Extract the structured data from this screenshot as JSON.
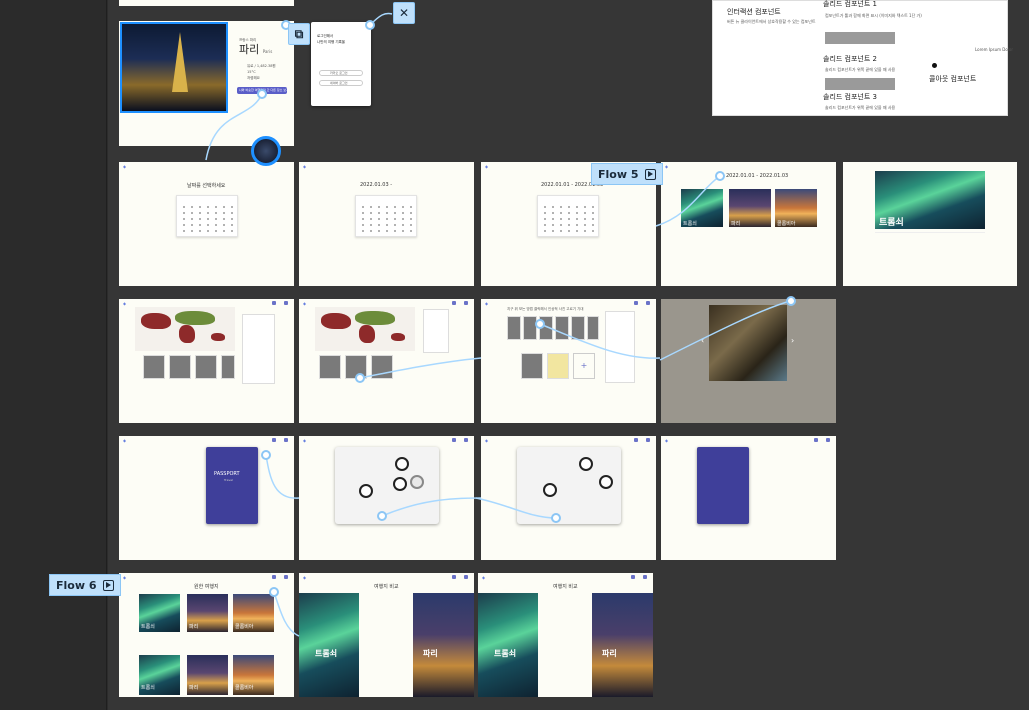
{
  "header_panel": {
    "interaction_title": "인터랙션 컴포넌트",
    "interaction_desc": "버튼 뉴 클라이언트에서 상호작용할 수 있는 컴포넌트",
    "solid1_title": "솔리드 컴포넌트 1",
    "solid1_desc": "컴포넌트가 툴과 함께 화면 표시 (이미지와 텍스트 1단 가)",
    "solid2_title": "솔리드 컴포넌트 2",
    "solid2_desc": "솔리드 컴포넌트가 위쪽 끝에 있을 때 사용",
    "solid3_title": "솔리드 컴포넌트 3",
    "solid3_desc": "솔리드 컴포넌트가 위쪽 끝에 있을 때 사용",
    "hover_title": "콜아웃 컴포넌트",
    "hover_note": "Lorem Ipsum Dolor"
  },
  "paris_card": {
    "subtitle": "프랑스 파리",
    "city": "파리",
    "city_sub": "Paris",
    "info1": "유로 / 1,482.38원",
    "info2": "15°C",
    "info3": "저렴해요",
    "cta": "나와 비슷한 여행자가 간 다른 장소 보기"
  },
  "login_modal": {
    "line1": "로그인해서",
    "line2": "나만의 여행 기록을",
    "btn1": "카카오 로그인",
    "btn2": "네이버 로그인"
  },
  "calendar_frames": [
    {
      "title": "날짜를 선택하세요"
    },
    {
      "title": "2022.01.03 -"
    },
    {
      "title": "2022.01.01 - 2022.01.03"
    }
  ],
  "results_frame": {
    "title": "2022.01.01 - 2022.01.03",
    "city1": "트롬쇠",
    "city2": "파리",
    "city3": "콜롬비아"
  },
  "detail_frame": {
    "city": "트롬쇠"
  },
  "map_frames": [
    {
      "hint": ""
    },
    {
      "hint": ""
    },
    {
      "hint": "지구 위 보는 방법 클릭해서 인상적 사진 고르기 기대"
    }
  ],
  "passport_frame": {
    "title": "PASSPORT",
    "sub": "Travel"
  },
  "compare_frames": [
    {
      "title": "원한 여행지",
      "c1": "트롬쇠",
      "c2": "파리",
      "c3": "콜롬비아",
      "c4": "트롬쇠",
      "c5": "파리",
      "c6": "콜롬비아"
    },
    {
      "title": "여행지 비교",
      "left": "트롬쇠",
      "right": "파리"
    },
    {
      "title": "여행지 비교",
      "left": "트롬쇠",
      "right": "파리"
    }
  ],
  "flows": {
    "flow5": "Flow 5",
    "flow6": "Flow 6"
  },
  "colors": {
    "canvas": "#363636",
    "frame": "#fdfdf6",
    "accent": "#5a5ec8",
    "flow_tag": "#bfe0fb",
    "link": "#a8d8ff"
  }
}
